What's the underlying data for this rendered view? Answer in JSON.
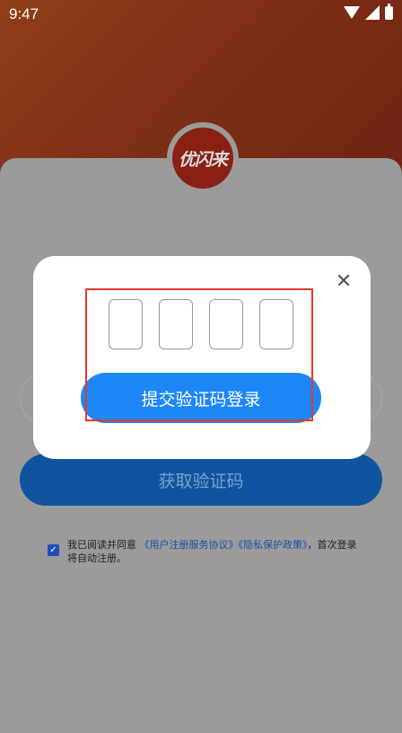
{
  "status_bar": {
    "time": "9:47"
  },
  "logo": {
    "text": "优闪来"
  },
  "main": {
    "get_code_label": "获取验证码",
    "agreement": {
      "prefix": "我已阅读并同意",
      "link1": "《用户注册服务协议》",
      "link2": "《隐私保护政策》",
      "suffix": "，首次登录将自动注册。"
    }
  },
  "modal": {
    "close_symbol": "✕",
    "code_digits": [
      "",
      "",
      "",
      ""
    ],
    "submit_label": "提交验证码登录"
  },
  "colors": {
    "accent": "#1e87f7",
    "highlight": "#e23a2c",
    "brand": "#8a1f14"
  }
}
